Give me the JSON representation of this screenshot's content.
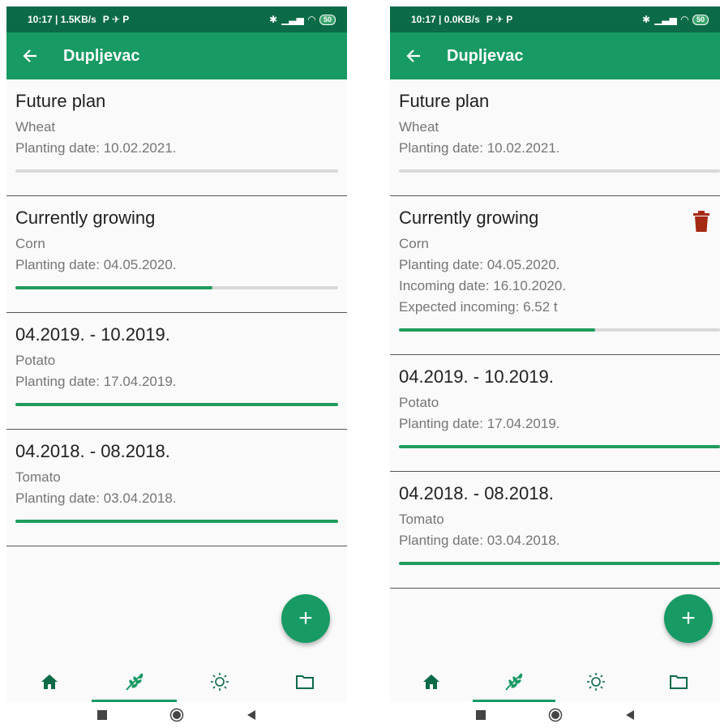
{
  "colors": {
    "primary": "#179a63",
    "statusbar": "#0b6b47",
    "progress": "#1f9d5c",
    "track": "#d9d9d9",
    "trash": "#a52a14"
  },
  "left": {
    "status": {
      "time_speed": "10:17 | 1.5KB/s",
      "icons": "P ✈ P",
      "battery": "50"
    },
    "title": "Dupljevac",
    "cards": [
      {
        "title": "Future plan",
        "crop": "Wheat",
        "planting": "Planting date: 10.02.2021.",
        "progress": 0
      },
      {
        "title": "Currently growing",
        "crop": "Corn",
        "planting": "Planting date: 04.05.2020.",
        "progress": 0.61
      },
      {
        "title": "04.2019. - 10.2019.",
        "crop": "Potato",
        "planting": "Planting date: 17.04.2019.",
        "progress": 1
      },
      {
        "title": "04.2018. - 08.2018.",
        "crop": "Tomato",
        "planting": "Planting date: 03.04.2018.",
        "progress": 1
      }
    ]
  },
  "right": {
    "status": {
      "time_speed": "10:17 | 0.0KB/s",
      "icons": "P ✈ P",
      "battery": "50"
    },
    "title": "Dupljevac",
    "cards": [
      {
        "title": "Future plan",
        "crop": "Wheat",
        "planting": "Planting date: 10.02.2021.",
        "progress": 0
      },
      {
        "title": "Currently growing",
        "crop": "Corn",
        "planting": "Planting date: 04.05.2020.",
        "incoming": "Incoming date: 16.10.2020.",
        "expected": "Expected incoming: 6.52 t",
        "progress": 0.61
      },
      {
        "title": "04.2019. - 10.2019.",
        "crop": "Potato",
        "planting": "Planting date: 17.04.2019.",
        "progress": 1
      },
      {
        "title": "04.2018. - 08.2018.",
        "crop": "Tomato",
        "planting": "Planting date: 03.04.2018.",
        "progress": 1
      }
    ]
  },
  "fab_label": "+",
  "bottom_nav": [
    "home-icon",
    "plant-icon",
    "sun-icon",
    "folder-icon"
  ],
  "active_nav": 1
}
